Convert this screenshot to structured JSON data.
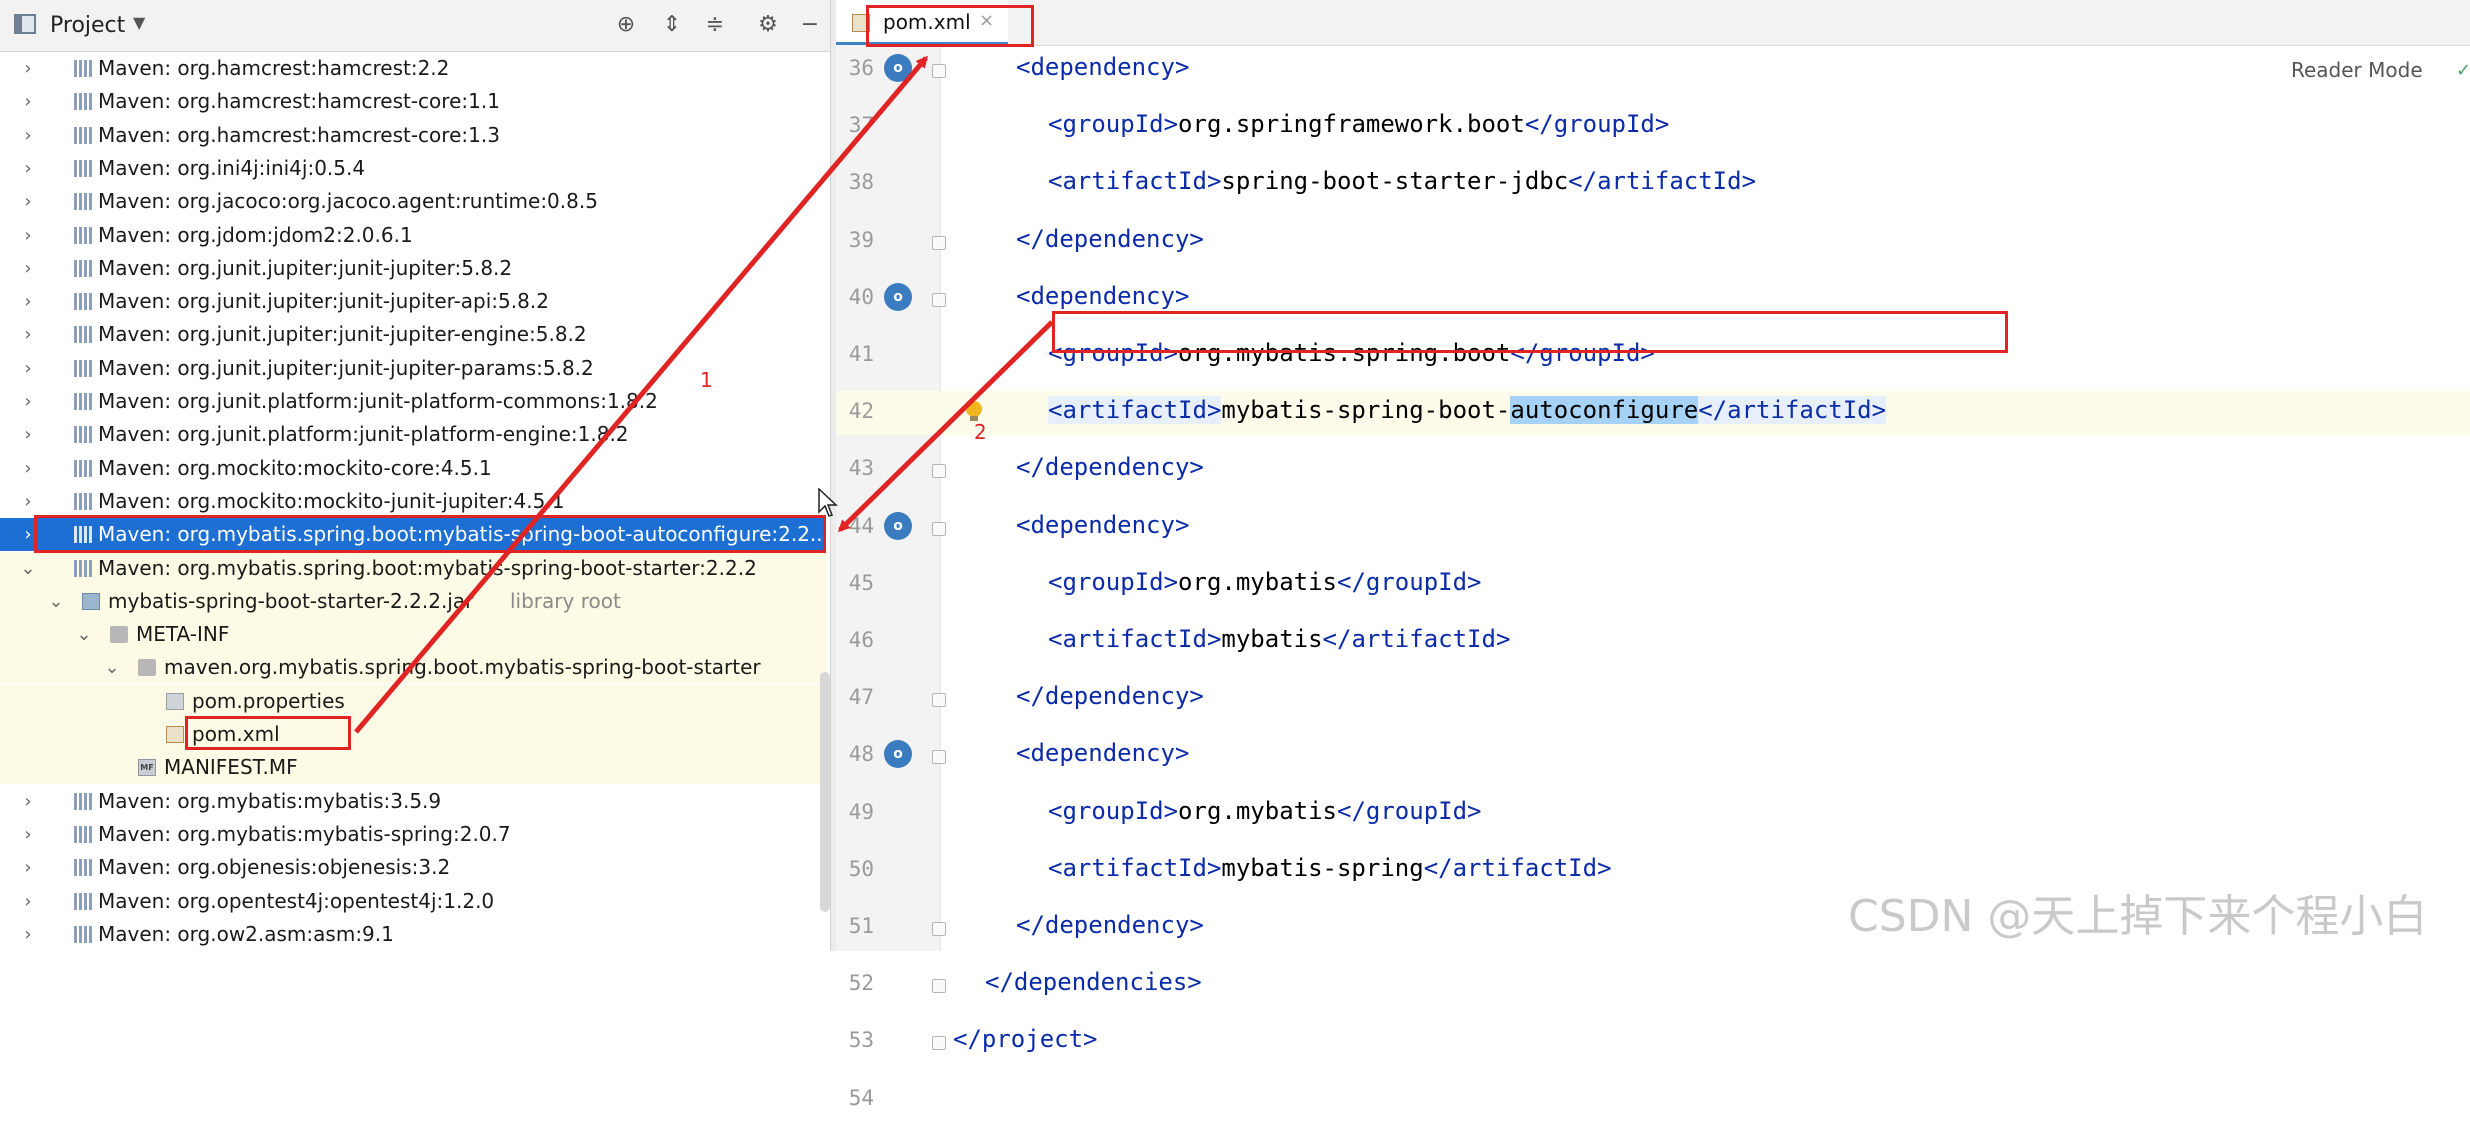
{
  "project_panel": {
    "title": "Project",
    "tree_rows": [
      {
        "label": "Maven: org.hamcrest:hamcrest:2.2"
      },
      {
        "label": "Maven: org.hamcrest:hamcrest-core:1.1"
      },
      {
        "label": "Maven: org.hamcrest:hamcrest-core:1.3"
      },
      {
        "label": "Maven: org.ini4j:ini4j:0.5.4"
      },
      {
        "label": "Maven: org.jacoco:org.jacoco.agent:runtime:0.8.5"
      },
      {
        "label": "Maven: org.jdom:jdom2:2.0.6.1"
      },
      {
        "label": "Maven: org.junit.jupiter:junit-jupiter:5.8.2"
      },
      {
        "label": "Maven: org.junit.jupiter:junit-jupiter-api:5.8.2"
      },
      {
        "label": "Maven: org.junit.jupiter:junit-jupiter-engine:5.8.2"
      },
      {
        "label": "Maven: org.junit.jupiter:junit-jupiter-params:5.8.2"
      },
      {
        "label": "Maven: org.junit.platform:junit-platform-commons:1.8.2"
      },
      {
        "label": "Maven: org.junit.platform:junit-platform-engine:1.8.2"
      },
      {
        "label": "Maven: org.mockito:mockito-core:4.5.1"
      },
      {
        "label": "Maven: org.mockito:mockito-junit-jupiter:4.5.1"
      },
      {
        "label": "Maven: org.mybatis.spring.boot:mybatis-spring-boot-autoconfigure:2.2.."
      },
      {
        "label": "Maven: org.mybatis.spring.boot:mybatis-spring-boot-starter:2.2.2"
      },
      {
        "label": "mybatis-spring-boot-starter-2.2.2.jar",
        "suffix": "library root"
      },
      {
        "label": "META-INF"
      },
      {
        "label": "maven.org.mybatis.spring.boot.mybatis-spring-boot-starter"
      },
      {
        "label": "pom.properties"
      },
      {
        "label": "pom.xml"
      },
      {
        "label": "MANIFEST.MF"
      },
      {
        "label": "Maven: org.mybatis:mybatis:3.5.9"
      },
      {
        "label": "Maven: org.mybatis:mybatis-spring:2.0.7"
      },
      {
        "label": "Maven: org.objenesis:objenesis:3.2"
      },
      {
        "label": "Maven: org.opentest4j:opentest4j:1.2.0"
      },
      {
        "label": "Maven: org.ow2.asm:asm:9.1"
      }
    ]
  },
  "editor": {
    "tab_label": "pom.xml",
    "tab_close": "×",
    "reader_mode": "Reader Mode",
    "lines": [
      {
        "num": "36",
        "parts": [
          {
            "t": "tag",
            "v": "<dependency>"
          }
        ]
      },
      {
        "num": "37",
        "parts": [
          {
            "t": "tag",
            "v": "<groupId>"
          },
          {
            "t": "txt",
            "v": "org.springframework.boot"
          },
          {
            "t": "tag",
            "v": "</groupId>"
          }
        ]
      },
      {
        "num": "38",
        "parts": [
          {
            "t": "tag",
            "v": "<artifactId>"
          },
          {
            "t": "txt",
            "v": "spring-boot-starter-jdbc"
          },
          {
            "t": "tag",
            "v": "</artifactId>"
          }
        ]
      },
      {
        "num": "39",
        "parts": [
          {
            "t": "tag",
            "v": "</dependency>"
          }
        ]
      },
      {
        "num": "40",
        "parts": [
          {
            "t": "tag",
            "v": "<dependency>"
          }
        ]
      },
      {
        "num": "41",
        "parts": [
          {
            "t": "tag",
            "v": "<groupId>"
          },
          {
            "t": "txt",
            "v": "org.mybatis.spring.boot"
          },
          {
            "t": "tag",
            "v": "</groupId>"
          }
        ]
      },
      {
        "num": "42",
        "parts": [
          {
            "t": "tag",
            "v": "<artifactId>"
          },
          {
            "t": "txt",
            "v": "mybatis-spring-boot-"
          },
          {
            "t": "sel",
            "v": "autoconfigure"
          },
          {
            "t": "tag",
            "v": "</artifactId>"
          }
        ]
      },
      {
        "num": "43",
        "parts": [
          {
            "t": "tag",
            "v": "</dependency>"
          }
        ]
      },
      {
        "num": "44",
        "parts": [
          {
            "t": "tag",
            "v": "<dependency>"
          }
        ]
      },
      {
        "num": "45",
        "parts": [
          {
            "t": "tag",
            "v": "<groupId>"
          },
          {
            "t": "txt",
            "v": "org.mybatis"
          },
          {
            "t": "tag",
            "v": "</groupId>"
          }
        ]
      },
      {
        "num": "46",
        "parts": [
          {
            "t": "tag",
            "v": "<artifactId>"
          },
          {
            "t": "txt",
            "v": "mybatis"
          },
          {
            "t": "tag",
            "v": "</artifactId>"
          }
        ]
      },
      {
        "num": "47",
        "parts": [
          {
            "t": "tag",
            "v": "</dependency>"
          }
        ]
      },
      {
        "num": "48",
        "parts": [
          {
            "t": "tag",
            "v": "<dependency>"
          }
        ]
      },
      {
        "num": "49",
        "parts": [
          {
            "t": "tag",
            "v": "<groupId>"
          },
          {
            "t": "txt",
            "v": "org.mybatis"
          },
          {
            "t": "tag",
            "v": "</groupId>"
          }
        ]
      },
      {
        "num": "50",
        "parts": [
          {
            "t": "tag",
            "v": "<artifactId>"
          },
          {
            "t": "txt",
            "v": "mybatis-spring"
          },
          {
            "t": "tag",
            "v": "</artifactId>"
          }
        ]
      },
      {
        "num": "51",
        "parts": [
          {
            "t": "tag",
            "v": "</dependency>"
          }
        ]
      },
      {
        "num": "52",
        "parts": [
          {
            "t": "tag",
            "v": "</dependencies>"
          }
        ]
      },
      {
        "num": "53",
        "parts": [
          {
            "t": "tag",
            "v": "</project>"
          }
        ]
      },
      {
        "num": "54",
        "parts": []
      }
    ]
  },
  "annotations": {
    "arrow_1_label": "1",
    "arrow_2_label": "2",
    "color": "#e02424"
  },
  "watermark": "CSDN @天上掉下来个程小白",
  "colors": {
    "selection": "#1e6fd3",
    "xml_tag": "#0b2ba8",
    "highlight_row": "#fdfbe6"
  }
}
